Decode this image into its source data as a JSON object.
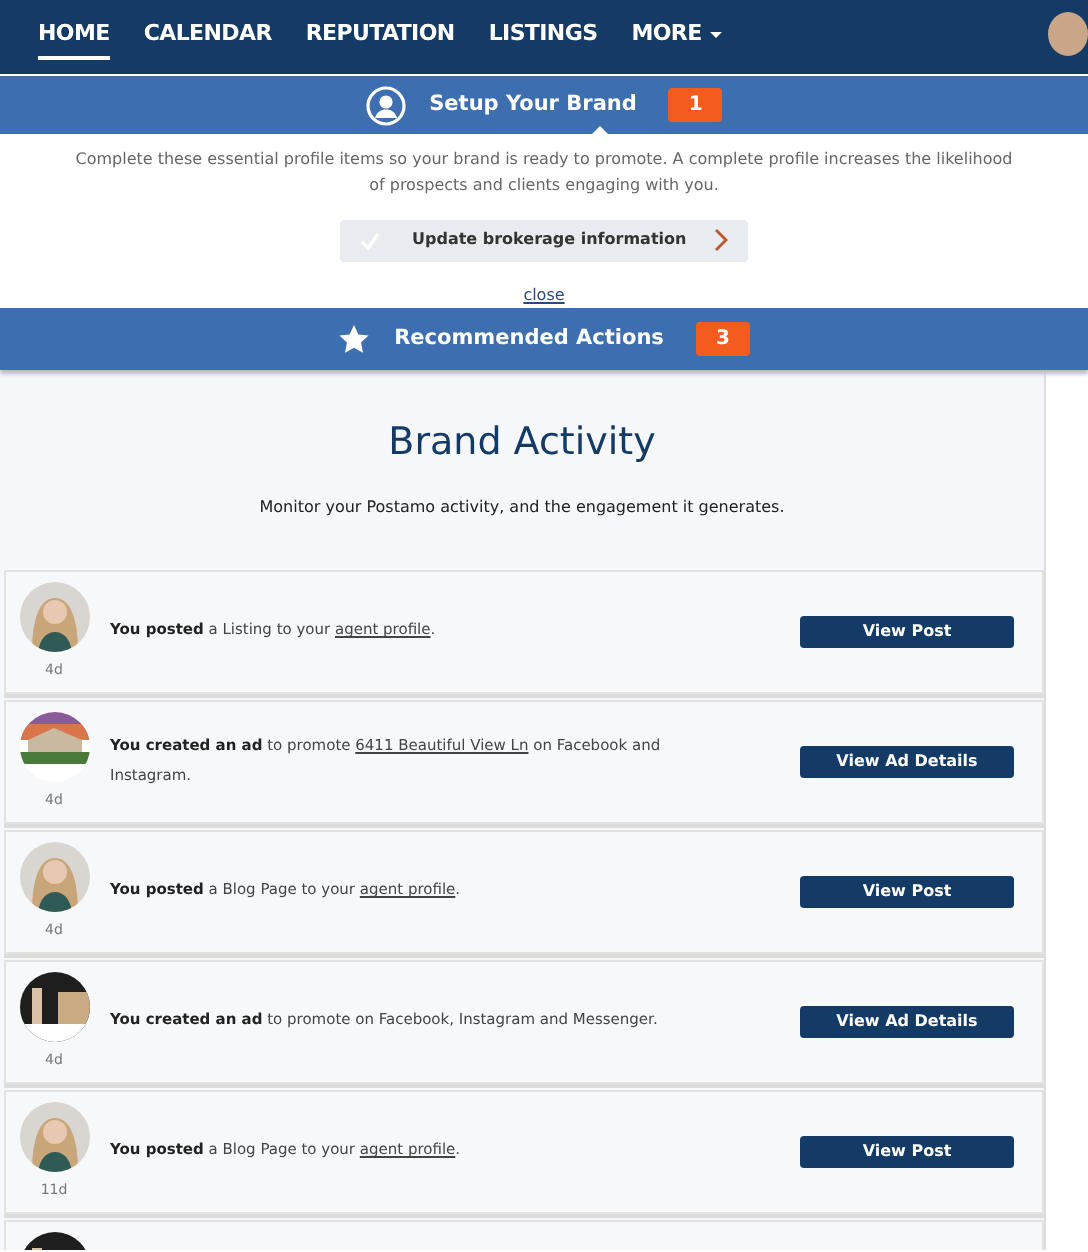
{
  "nav": {
    "items": [
      {
        "label": "HOME",
        "selected": true
      },
      {
        "label": "CALENDAR",
        "selected": false
      },
      {
        "label": "REPUTATION",
        "selected": false
      },
      {
        "label": "LISTINGS",
        "selected": false
      },
      {
        "label": "MORE",
        "selected": false,
        "dropdown": true
      }
    ]
  },
  "setup": {
    "title": "Setup Your Brand",
    "count": "1",
    "text": "Complete these essential profile items so your brand is ready to promote. A complete profile increases the likelihood of prospects and clients engaging with you.",
    "task": {
      "label": "Update brokerage information",
      "checked": false
    },
    "close": "close"
  },
  "recommended": {
    "title": "Recommended Actions",
    "count": "3"
  },
  "activity": {
    "title": "Brand Activity",
    "subtitle": "Monitor your Postamo activity, and the engagement it generates.",
    "items": [
      {
        "kind": "post",
        "age": "4d",
        "parts": [
          {
            "kind": "bold",
            "text": "You posted"
          },
          {
            "kind": "plain",
            "text": " a Listing to your "
          },
          {
            "kind": "link",
            "text": "agent profile"
          },
          {
            "kind": "plain",
            "text": "."
          }
        ],
        "button": "View Post"
      },
      {
        "kind": "post",
        "age": "4d",
        "parts": [
          {
            "kind": "bold",
            "text": "You created an ad"
          },
          {
            "kind": "plain",
            "text": " to promote "
          },
          {
            "kind": "link",
            "text": "6411 Beautiful View Ln"
          },
          {
            "kind": "plain",
            "text": " on Facebook and Instagram."
          }
        ],
        "button": "View Ad Details"
      },
      {
        "kind": "post",
        "age": "4d",
        "parts": [
          {
            "kind": "bold",
            "text": "You posted"
          },
          {
            "kind": "plain",
            "text": " a Blog Page to your "
          },
          {
            "kind": "link",
            "text": "agent profile"
          },
          {
            "kind": "plain",
            "text": "."
          }
        ],
        "button": "View Post"
      },
      {
        "kind": "post",
        "age": "4d",
        "parts": [
          {
            "kind": "bold",
            "text": "You created an ad"
          },
          {
            "kind": "plain",
            "text": " to promote on Facebook, Instagram and Messenger."
          }
        ],
        "button": "View Ad Details"
      },
      {
        "kind": "post",
        "age": "11d",
        "parts": [
          {
            "kind": "bold",
            "text": "You posted"
          },
          {
            "kind": "plain",
            "text": " a Blog Page to your "
          },
          {
            "kind": "link",
            "text": "agent profile"
          },
          {
            "kind": "plain",
            "text": "."
          }
        ],
        "button": "View Post"
      },
      {
        "kind": "picture"
      }
    ]
  }
}
